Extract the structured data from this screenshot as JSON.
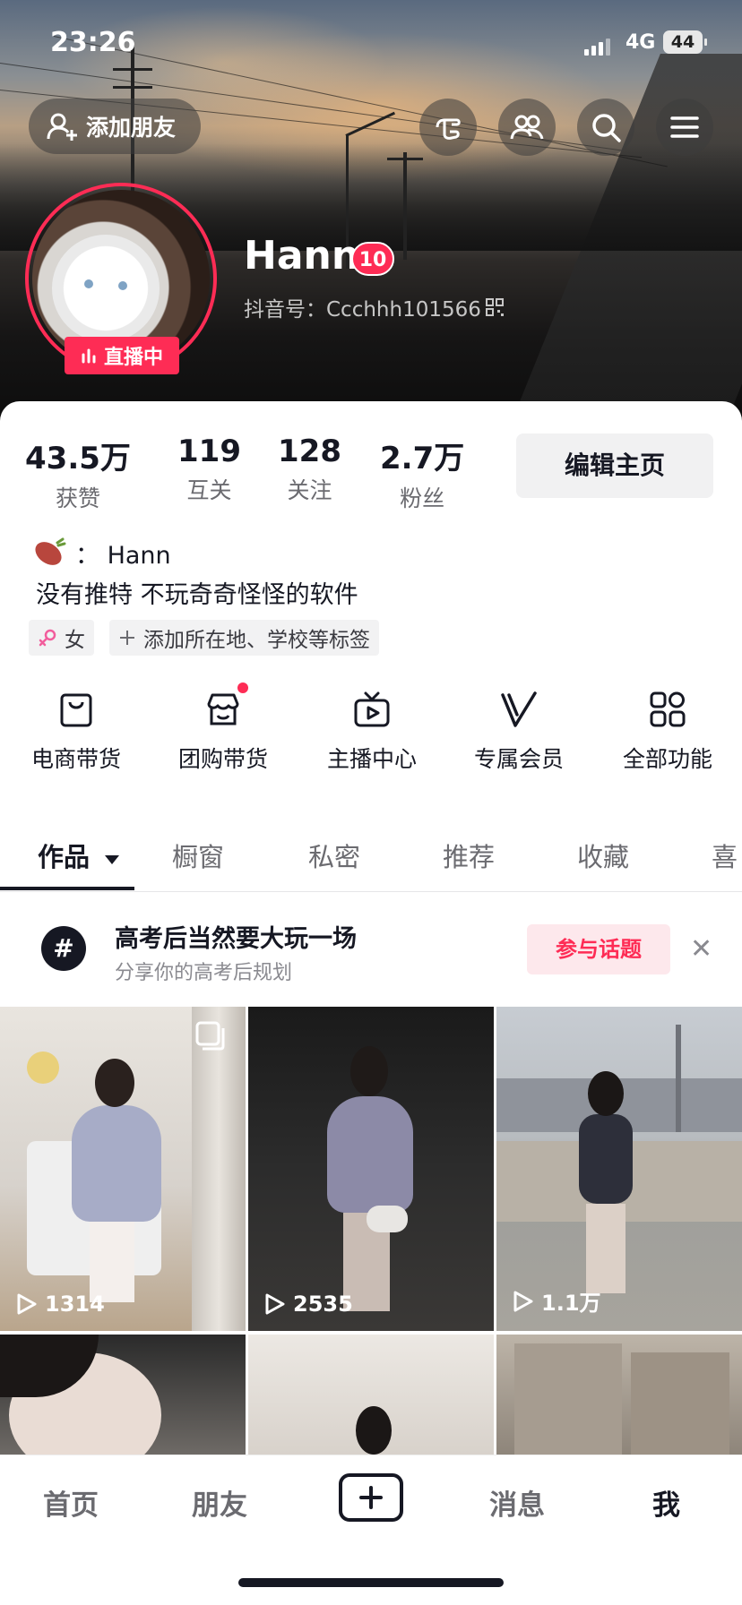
{
  "status_bar": {
    "time": "23:26",
    "network": "4G",
    "battery": "44"
  },
  "header": {
    "add_friend_label": "添加朋友"
  },
  "profile": {
    "name": "Hann",
    "level": "10",
    "douyin_id": "抖音号：Ccchhh101566",
    "live_label": "直播中"
  },
  "stats": [
    {
      "value": "43.5万",
      "label": "获赞"
    },
    {
      "value": "119",
      "label": "互关"
    },
    {
      "value": "128",
      "label": "关注"
    },
    {
      "value": "2.7万",
      "label": "粉丝"
    }
  ],
  "edit_profile_label": "编辑主页",
  "bio": {
    "line1": "：  Hann",
    "line2": "没有推特 不玩奇奇怪怪的软件"
  },
  "tags": {
    "gender": "女",
    "add_tag": "添加所在地、学校等标签"
  },
  "features": [
    {
      "label": "电商带货",
      "icon": "shopping-bag-icon"
    },
    {
      "label": "团购带货",
      "icon": "store-icon"
    },
    {
      "label": "主播中心",
      "icon": "tv-icon"
    },
    {
      "label": "专属会员",
      "icon": "vip-v-icon"
    },
    {
      "label": "全部功能",
      "icon": "grid-apps-icon"
    }
  ],
  "tabs": [
    "作品",
    "橱窗",
    "私密",
    "推荐",
    "收藏",
    "喜"
  ],
  "topic": {
    "title": "高考后当然要大玩一场",
    "subtitle": "分享你的高考后规划",
    "join_label": "参与话题"
  },
  "videos": [
    {
      "plays": "1314"
    },
    {
      "plays": "2535"
    },
    {
      "plays": "1.1万"
    }
  ],
  "bottom_nav": {
    "home": "首页",
    "friends": "朋友",
    "messages": "消息",
    "me": "我"
  },
  "colors": {
    "accent": "#fe2c55",
    "text": "#161823"
  }
}
